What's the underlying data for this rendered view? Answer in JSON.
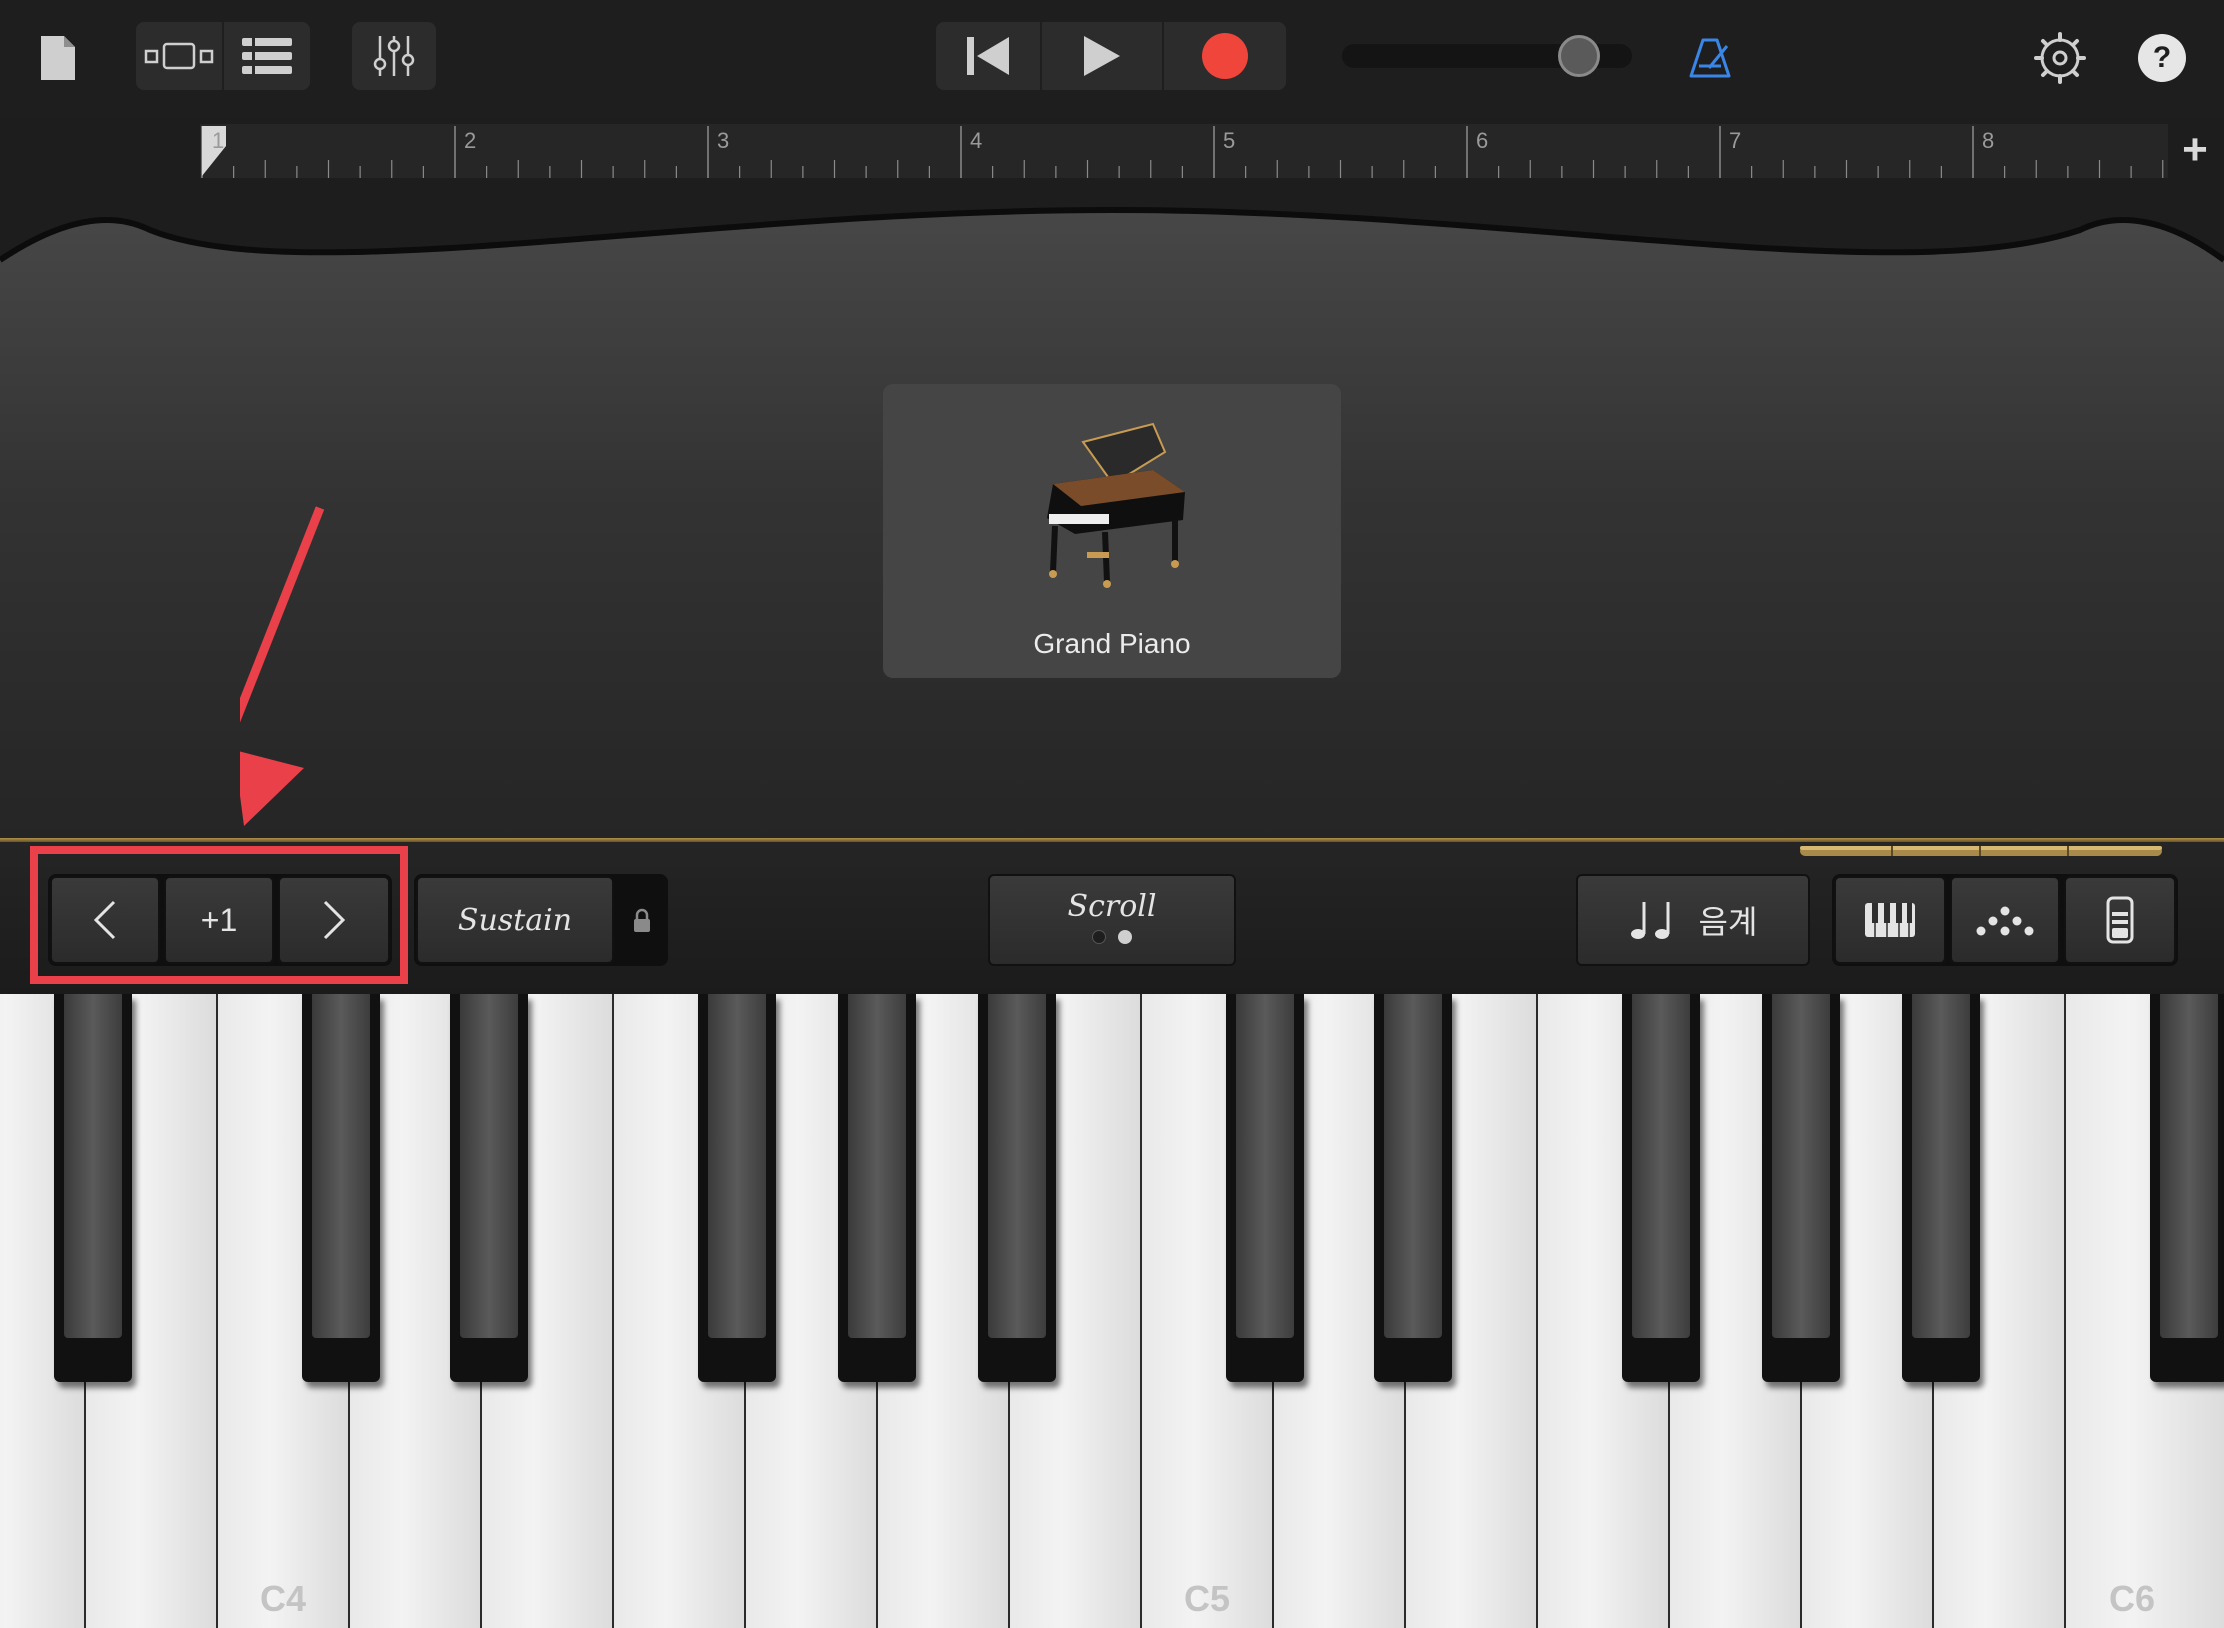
{
  "toolbar": {
    "icons": {
      "document": "document-icon",
      "tracks_view": "tracks-view-icon",
      "list_view": "list-view-icon",
      "mixer": "mixer-sliders-icon",
      "rewind": "rewind-icon",
      "play": "play-icon",
      "record": "record-icon",
      "metronome": "metronome-icon",
      "settings": "settings-gear-icon",
      "help": "help-icon"
    },
    "help_label": "?",
    "record_color": "#f0453a",
    "metronome_color": "#3a86e8",
    "master_volume_fraction": 0.88
  },
  "ruler": {
    "bars": [
      "1",
      "2",
      "3",
      "4",
      "5",
      "6",
      "7",
      "8"
    ],
    "add_label": "+"
  },
  "instrument": {
    "name": "Grand Piano",
    "image": "grand-piano-image"
  },
  "controls": {
    "octave_down_icon": "chevron-left-icon",
    "octave_value": "+1",
    "octave_up_icon": "chevron-right-icon",
    "sustain_label": "Sustain",
    "sustain_lock_icon": "lock-icon",
    "scroll_label": "Scroll",
    "scale_icon": "music-notes-icon",
    "scale_label": "음계",
    "layout_icons": [
      "keyboard-layout-icon",
      "arpeggiator-icon",
      "velocity-icon"
    ]
  },
  "annotation": {
    "color": "#e9404a"
  },
  "keyboard": {
    "labels": {
      "c4": "C4",
      "c5": "C5",
      "c6": "C6"
    }
  }
}
